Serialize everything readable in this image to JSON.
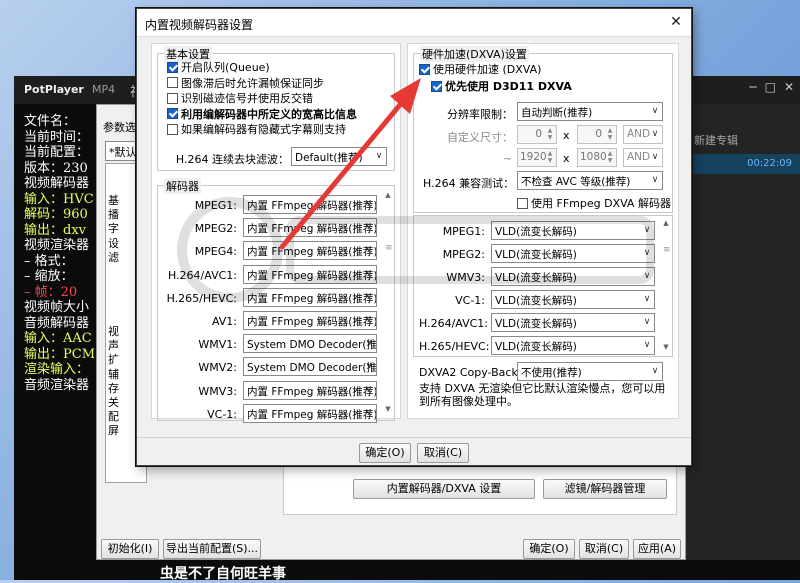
{
  "potplayer": {
    "app_name": "PotPlayer",
    "tab": "MP4",
    "title_fragment": "视",
    "subtitle_text": "虫是不了自何旺羊事",
    "right_header": "新建专辑",
    "right_time": "00:22:09",
    "osd_lines": [
      {
        "text": "文件名：",
        "cls": ""
      },
      {
        "text": "当前时间：",
        "cls": ""
      },
      {
        "text": "当前配置：",
        "cls": ""
      },
      {
        "text": "版本：230",
        "cls": ""
      },
      {
        "text": "视频解码器",
        "cls": ""
      },
      {
        "text": "输入：HVC",
        "cls": ""
      },
      {
        "text": "解码：960",
        "cls": ""
      },
      {
        "text": "输出：dxv",
        "cls": ""
      },
      {
        "text": "视频渲染器",
        "cls": ""
      },
      {
        "text": "  – 格式：",
        "cls": ""
      },
      {
        "text": "  – 缩放：",
        "cls": ""
      },
      {
        "text": "  – 帧：20",
        "cls": "r"
      },
      {
        "text": "视频帧大小",
        "cls": ""
      },
      {
        "text": "音频解码器",
        "cls": ""
      },
      {
        "text": "输入：AAC",
        "cls": ""
      },
      {
        "text": "输出：PCM",
        "cls": ""
      },
      {
        "text": "渲染输入：",
        "cls": ""
      },
      {
        "text": "音频渲染器",
        "cls": ""
      }
    ]
  },
  "preferences": {
    "header_label": "参数选",
    "combo_value": "*默认",
    "tree_items": [
      "基",
      "播",
      "字",
      "设",
      "滤",
      "视",
      "声",
      "扩",
      "辅",
      "存",
      "关",
      "配",
      "屏"
    ],
    "btn_builtin_decoder": "内置解码器/DXVA 设置",
    "btn_filter_manager": "滤镜/解码器管理",
    "btn_init": "初始化(I)",
    "btn_export": "导出当前配置(S)...",
    "btn_ok": "确定(O)",
    "btn_cancel": "取消(C)",
    "btn_apply": "应用(A)"
  },
  "dialog": {
    "title": "内置视频解码器设置",
    "basic_settings": {
      "group_label": "基本设置",
      "options": [
        {
          "label": "开启队列(Queue)",
          "checked": true,
          "bold": false
        },
        {
          "label": "图像滞后时允许漏帧保证同步",
          "checked": false,
          "bold": false
        },
        {
          "label": "识别磁迹信号并使用反交错",
          "checked": false,
          "bold": false
        },
        {
          "label": "利用编解码器中所定义的宽高比信息",
          "checked": true,
          "bold": true
        },
        {
          "label": "如果编解码器有隐藏式字幕则支持",
          "checked": false,
          "bold": false
        }
      ],
      "deblock_label": "H.264 连续去块滤波：",
      "deblock_value": "Default(推荐)"
    },
    "decoders": {
      "group_label": "解码器",
      "rows": [
        {
          "label": "MPEG1:",
          "value": "内置 FFmpeg 解码器(推荐)"
        },
        {
          "label": "MPEG2:",
          "value": "内置 FFmpeg 解码器(推荐)"
        },
        {
          "label": "MPEG4:",
          "value": "内置 FFmpeg 解码器(推荐)"
        },
        {
          "label": "H.264/AVC1:",
          "value": "内置 FFmpeg 解码器(推荐)"
        },
        {
          "label": "H.265/HEVC:",
          "value": "内置 FFmpeg 解码器(推荐)"
        },
        {
          "label": "AV1:",
          "value": "内置 FFmpeg 解码器(推荐)"
        },
        {
          "label": "WMV1:",
          "value": "System DMO Decoder(推荐)"
        },
        {
          "label": "WMV2:",
          "value": "System DMO Decoder(推荐)"
        },
        {
          "label": "WMV3:",
          "value": "内置 FFmpeg 解码器(推荐)"
        },
        {
          "label": "VC-1:",
          "value": "内置 FFmpeg 解码器(推荐)"
        }
      ]
    },
    "hw": {
      "group_label": "硬件加速(DXVA)设置",
      "use_hw_label": "使用硬件加速 (DXVA)",
      "use_hw_checked": true,
      "d3d11_label": "优先使用 D3D11 DXVA",
      "d3d11_checked": true,
      "resolution_label": "分辨率限制：",
      "resolution_value": "自动判断(推荐)",
      "custom_size_label": "自定义尺寸：",
      "custom_w1": "0",
      "custom_h1": "0",
      "custom_w2": "1920",
      "custom_h2": "1080",
      "x_sign": "x",
      "tilde": "~",
      "and_label": "AND",
      "h264_compat_label": "H.264 兼容测试：",
      "h264_compat_value": "不检查 AVC 等级(推荐)",
      "ffmpeg_dxva_label": "使用 FFmpeg DXVA 解码器",
      "ffmpeg_dxva_checked": false,
      "rows": [
        {
          "label": "MPEG1:",
          "value": "VLD(流变长解码)"
        },
        {
          "label": "MPEG2:",
          "value": "VLD(流变长解码)"
        },
        {
          "label": "WMV3:",
          "value": "VLD(流变长解码)"
        },
        {
          "label": "VC-1:",
          "value": "VLD(流变长解码)"
        },
        {
          "label": "H.264/AVC1:",
          "value": "VLD(流变长解码)"
        },
        {
          "label": "H.265/HEVC:",
          "value": "VLD(流变长解码)"
        }
      ],
      "copyback_label": "DXVA2 Copy-Back:",
      "copyback_value": "不使用(推荐)",
      "note": "支持 DXVA 无渲染但它比默认渲染慢点，您可以用到所有图像处理中。"
    },
    "ok_label": "确定(O)",
    "cancel_label": "取消(C)"
  },
  "colors": {
    "accent_checkbox": "#1a63c9",
    "arrow_red": "#e53935",
    "osd_yellow": "#e8ff60",
    "dark_chrome": "#1e1e1e"
  }
}
